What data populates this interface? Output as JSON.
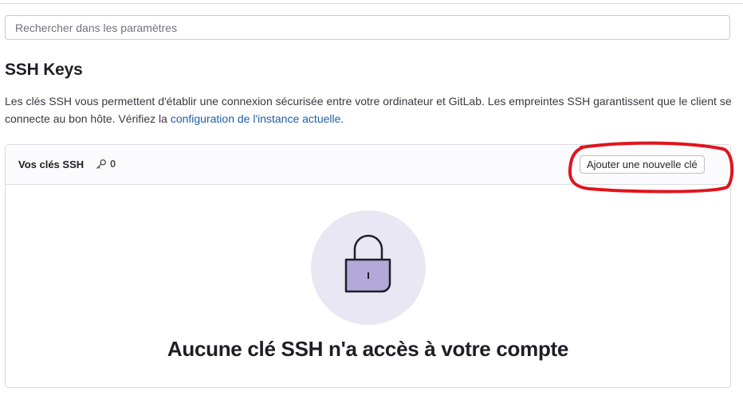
{
  "search": {
    "placeholder": "Rechercher dans les paramètres",
    "value": ""
  },
  "section": {
    "title": "SSH Keys",
    "description_text": "Les clés SSH vous permettent d'établir une connexion sécurisée entre votre ordinateur et GitLab. Les empreintes SSH garantissent que le client se connecte au bon hôte. Vérifiez la ",
    "description_link": "configuration de l'instance actuelle",
    "description_end": "."
  },
  "keys_card": {
    "title": "Vos clés SSH",
    "count_icon": "key-icon",
    "count": "0",
    "add_button_label": "Ajouter une nouvelle clé",
    "empty_state": {
      "illustration_icon": "lock-icon",
      "title": "Aucune clé SSH n'a accès à votre compte"
    }
  },
  "colors": {
    "link": "#1f5ea8",
    "annotation": "#e0141e",
    "illustration_bg": "#eae7f4",
    "lock_body": "#b2a9d9"
  }
}
